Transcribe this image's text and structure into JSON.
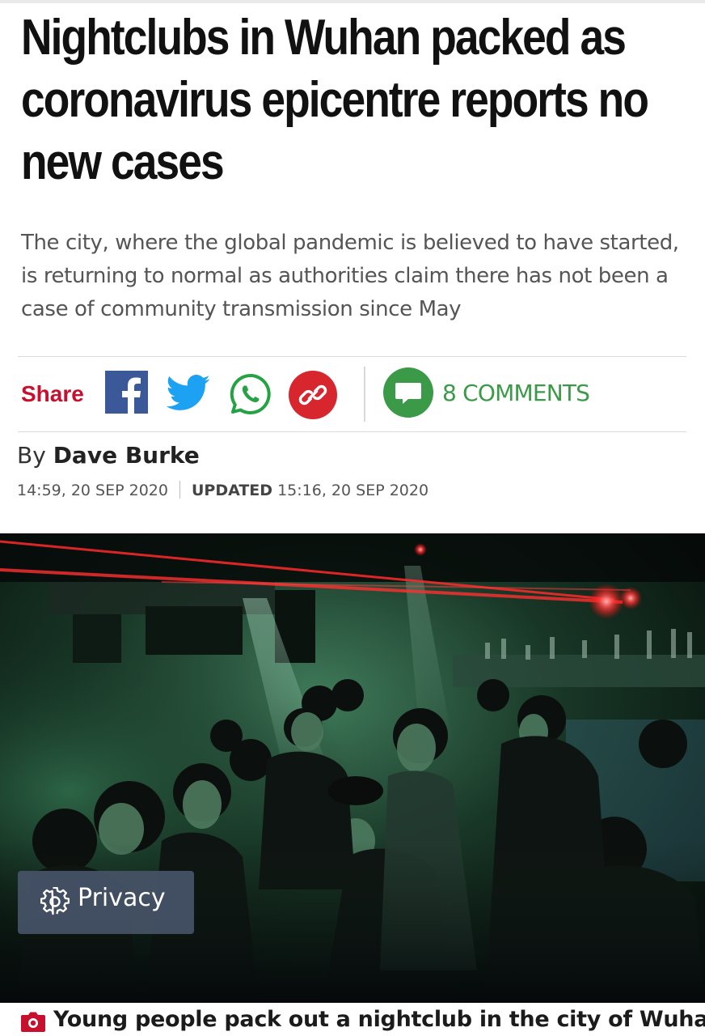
{
  "article": {
    "headline": "Nightclubs in Wuhan packed as coronavirus epicentre reports no new cases",
    "standfirst": "The city, where the global pandemic is believed to have started, is returning to normal as authorities claim there has not been a case of community transmission since May"
  },
  "share_bar": {
    "share_label": "Share",
    "icons": [
      "facebook-icon",
      "twitter-icon",
      "whatsapp-icon",
      "link-icon"
    ],
    "comments_icon": "comment-bubble-icon",
    "comments_count": "8",
    "comments_label": "COMMENTS"
  },
  "byline": {
    "by": "By",
    "author": "Dave Burke",
    "published": "14:59, 20 SEP 2020",
    "updated_label": "UPDATED",
    "updated": "15:16, 20 SEP 2020"
  },
  "media": {
    "privacy_icon": "gear-icon",
    "privacy_label": "Privacy",
    "caption_icon": "camera-icon",
    "caption": "Young people pack out a nightclub in the city of Wuhan"
  },
  "colors": {
    "brand_red": "#c8102e",
    "facebook": "#3b5998",
    "twitter": "#1da1f2",
    "whatsapp": "#25a244",
    "comments_green": "#3b9a48",
    "privacy_bg": "#465468"
  }
}
